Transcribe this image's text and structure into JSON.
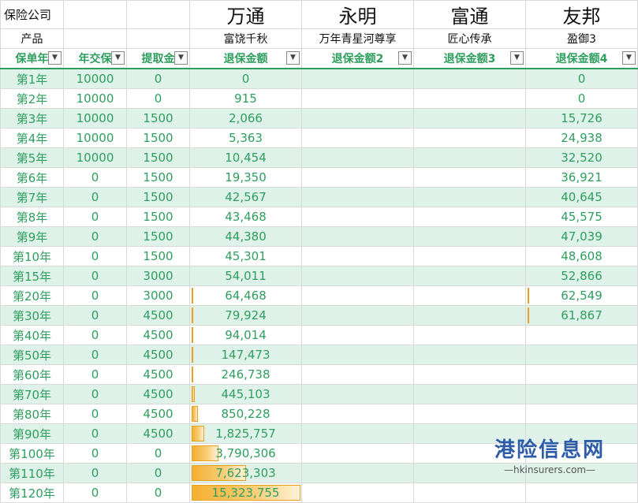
{
  "header": {
    "corner_company": "保险公司",
    "corner_product": "产品",
    "companies": [
      "万通",
      "永明",
      "富通",
      "友邦"
    ],
    "products": [
      "富饶千秋",
      "万年青星河尊享",
      "匠心传承",
      "盈御3"
    ],
    "columns": [
      "保单年",
      "年交保",
      "提取金",
      "退保金额",
      "退保金额2",
      "退保金额3",
      "退保金额4"
    ],
    "filter_icon": "dropdown-arrow-icon"
  },
  "rows": [
    {
      "year": "第1年",
      "premium": "10000",
      "withdrawal": "0",
      "v1": "0",
      "v2": "",
      "v3": "",
      "v4": "0",
      "bar1": 0,
      "bar4": 0
    },
    {
      "year": "第2年",
      "premium": "10000",
      "withdrawal": "0",
      "v1": "915",
      "v2": "",
      "v3": "",
      "v4": "0",
      "bar1": 0,
      "bar4": 0
    },
    {
      "year": "第3年",
      "premium": "10000",
      "withdrawal": "1500",
      "v1": "2,066",
      "v2": "",
      "v3": "",
      "v4": "15,726",
      "bar1": 0,
      "bar4": 0
    },
    {
      "year": "第4年",
      "premium": "10000",
      "withdrawal": "1500",
      "v1": "5,363",
      "v2": "",
      "v3": "",
      "v4": "24,938",
      "bar1": 0,
      "bar4": 0
    },
    {
      "year": "第5年",
      "premium": "10000",
      "withdrawal": "1500",
      "v1": "10,454",
      "v2": "",
      "v3": "",
      "v4": "32,520",
      "bar1": 0,
      "bar4": 0
    },
    {
      "year": "第6年",
      "premium": "0",
      "withdrawal": "1500",
      "v1": "19,350",
      "v2": "",
      "v3": "",
      "v4": "36,921",
      "bar1": 0,
      "bar4": 0
    },
    {
      "year": "第7年",
      "premium": "0",
      "withdrawal": "1500",
      "v1": "42,567",
      "v2": "",
      "v3": "",
      "v4": "40,645",
      "bar1": 0,
      "bar4": 0
    },
    {
      "year": "第8年",
      "premium": "0",
      "withdrawal": "1500",
      "v1": "43,468",
      "v2": "",
      "v3": "",
      "v4": "45,575",
      "bar1": 0,
      "bar4": 0
    },
    {
      "year": "第9年",
      "premium": "0",
      "withdrawal": "1500",
      "v1": "44,380",
      "v2": "",
      "v3": "",
      "v4": "47,039",
      "bar1": 0,
      "bar4": 0
    },
    {
      "year": "第10年",
      "premium": "0",
      "withdrawal": "1500",
      "v1": "45,301",
      "v2": "",
      "v3": "",
      "v4": "48,608",
      "bar1": 0,
      "bar4": 0
    },
    {
      "year": "第15年",
      "premium": "0",
      "withdrawal": "3000",
      "v1": "54,011",
      "v2": "",
      "v3": "",
      "v4": "52,866",
      "bar1": 0,
      "bar4": 0
    },
    {
      "year": "第20年",
      "premium": "0",
      "withdrawal": "3000",
      "v1": "64,468",
      "v2": "",
      "v3": "",
      "v4": "62,549",
      "bar1": 0.004,
      "bar4": 0.01
    },
    {
      "year": "第30年",
      "premium": "0",
      "withdrawal": "4500",
      "v1": "79,924",
      "v2": "",
      "v3": "",
      "v4": "61,867",
      "bar1": 0.005,
      "bar4": 0.01
    },
    {
      "year": "第40年",
      "premium": "0",
      "withdrawal": "4500",
      "v1": "94,014",
      "v2": "",
      "v3": "",
      "v4": "",
      "bar1": 0.006,
      "bar4": 0
    },
    {
      "year": "第50年",
      "premium": "0",
      "withdrawal": "4500",
      "v1": "147,473",
      "v2": "",
      "v3": "",
      "v4": "",
      "bar1": 0.01,
      "bar4": 0
    },
    {
      "year": "第60年",
      "premium": "0",
      "withdrawal": "4500",
      "v1": "246,738",
      "v2": "",
      "v3": "",
      "v4": "",
      "bar1": 0.016,
      "bar4": 0
    },
    {
      "year": "第70年",
      "premium": "0",
      "withdrawal": "4500",
      "v1": "445,103",
      "v2": "",
      "v3": "",
      "v4": "",
      "bar1": 0.029,
      "bar4": 0
    },
    {
      "year": "第80年",
      "premium": "0",
      "withdrawal": "4500",
      "v1": "850,228",
      "v2": "",
      "v3": "",
      "v4": "",
      "bar1": 0.055,
      "bar4": 0
    },
    {
      "year": "第90年",
      "premium": "0",
      "withdrawal": "4500",
      "v1": "1,825,757",
      "v2": "",
      "v3": "",
      "v4": "",
      "bar1": 0.119,
      "bar4": 0
    },
    {
      "year": "第100年",
      "premium": "0",
      "withdrawal": "0",
      "v1": "3,790,306",
      "v2": "",
      "v3": "",
      "v4": "",
      "bar1": 0.247,
      "bar4": 0
    },
    {
      "year": "第110年",
      "premium": "0",
      "withdrawal": "0",
      "v1": "7,623,303",
      "v2": "",
      "v3": "",
      "v4": "",
      "bar1": 0.497,
      "bar4": 0
    },
    {
      "year": "第120年",
      "premium": "0",
      "withdrawal": "0",
      "v1": "15,323,755",
      "v2": "",
      "v3": "",
      "v4": "",
      "bar1": 1.0,
      "bar4": 0
    }
  ],
  "watermark": {
    "cn": "港险信息网",
    "en": "—hkinsurers.com—"
  },
  "colors": {
    "accent_green": "#2e9e5e",
    "band": "#def2ea",
    "bar": "#f4b030",
    "watermark_blue": "#2d5ca8"
  }
}
